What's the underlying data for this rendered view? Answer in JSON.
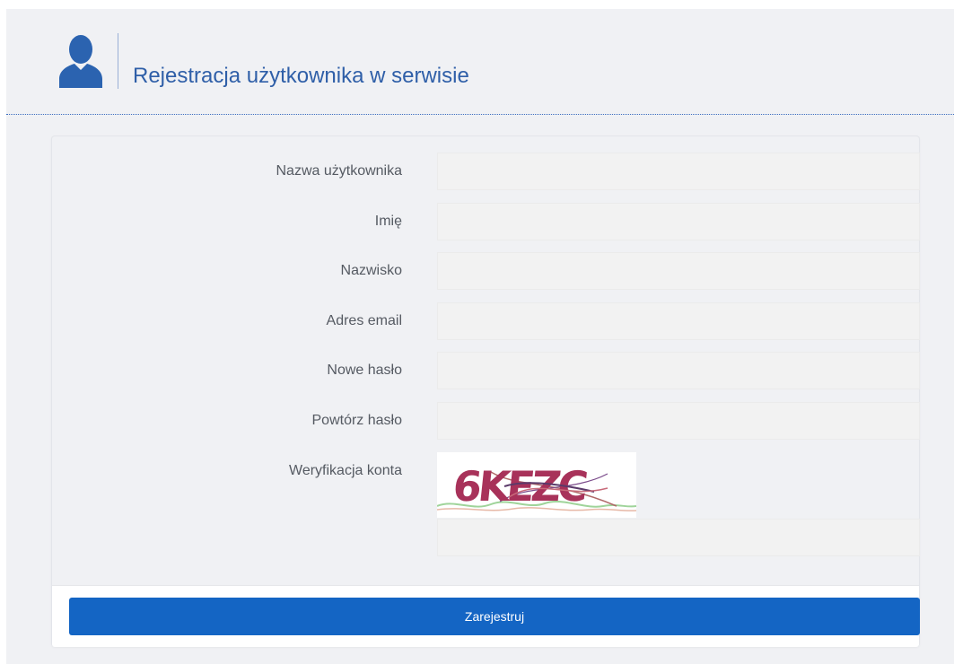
{
  "header": {
    "icon": "user-silhouette-icon",
    "title": "Rejestracja użytkownika w serwisie"
  },
  "form": {
    "fields": [
      {
        "label": "Nazwa użytkownika",
        "value": "",
        "placeholder": ""
      },
      {
        "label": "Imię",
        "value": "",
        "placeholder": ""
      },
      {
        "label": "Nazwisko",
        "value": "",
        "placeholder": ""
      },
      {
        "label": "Adres email",
        "value": "",
        "placeholder": ""
      },
      {
        "label": "Nowe hasło",
        "value": "",
        "placeholder": ""
      },
      {
        "label": "Powtórz hasło",
        "value": "",
        "placeholder": ""
      }
    ],
    "captcha": {
      "label": "Weryfikacja konta",
      "image_text": "6KEZC",
      "value": "",
      "placeholder": ""
    },
    "submit_label": "Zarejestruj"
  },
  "colors": {
    "accent": "#1465c4",
    "title": "#2f5fa8",
    "page_background": "#f0f1f4"
  }
}
